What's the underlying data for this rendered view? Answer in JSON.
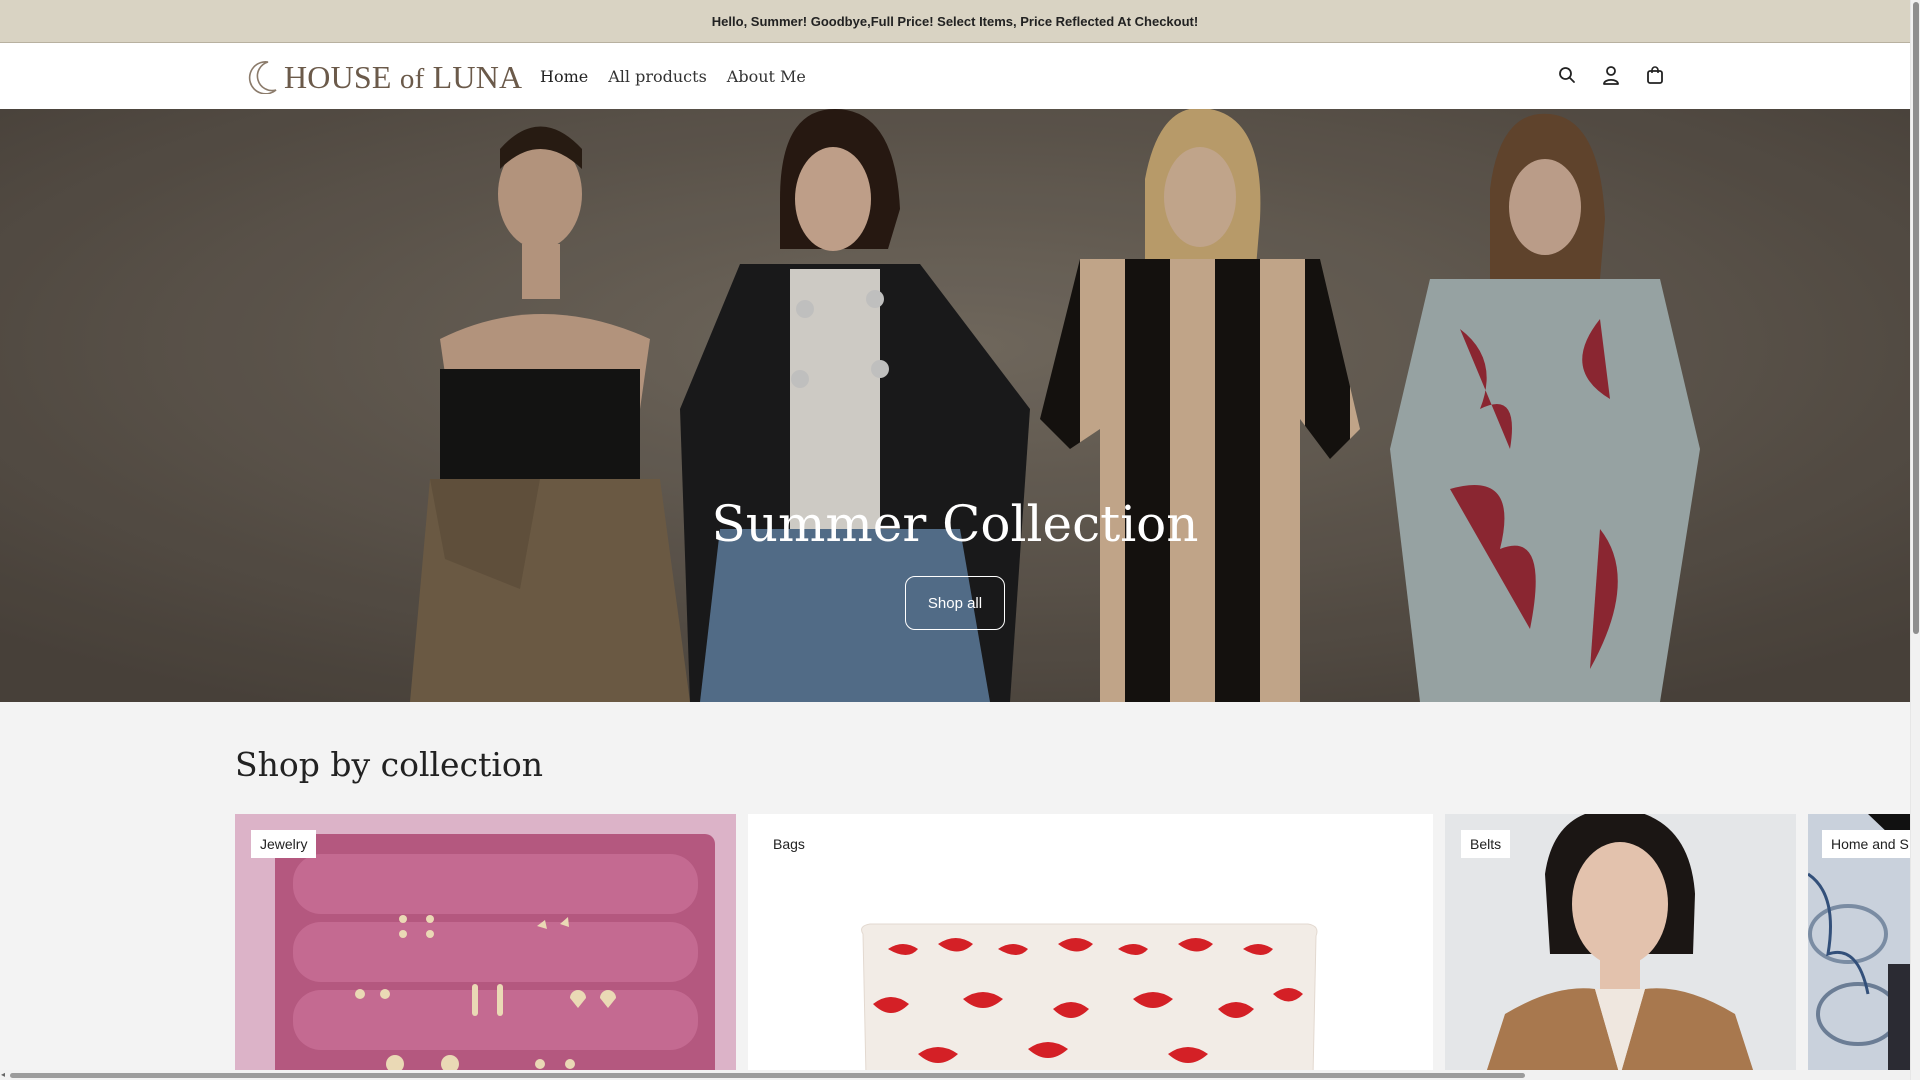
{
  "announcement": {
    "text": "Hello, Summer! Goodbye,Full Price! Select Items, Price Reflected At Checkout!"
  },
  "header": {
    "logo_text": "HOUSE",
    "logo_of": "of",
    "logo_text2": "LUNA",
    "nav": [
      "Home",
      "All products",
      "About Me"
    ],
    "icons": [
      "search-icon",
      "account-icon",
      "cart-bag-icon"
    ]
  },
  "hero": {
    "title": "Summer Collection",
    "button_label": "Shop all"
  },
  "collections": {
    "title": "Shop by collection",
    "items": [
      {
        "label": "Jewelry"
      },
      {
        "label": "Bags"
      },
      {
        "label": "Belts"
      },
      {
        "label": "Home and S"
      }
    ]
  },
  "colors": {
    "announcement_bg": "#d9d3c3",
    "logo": "#6b5a4a",
    "page_bg": "#f3f3f3"
  }
}
